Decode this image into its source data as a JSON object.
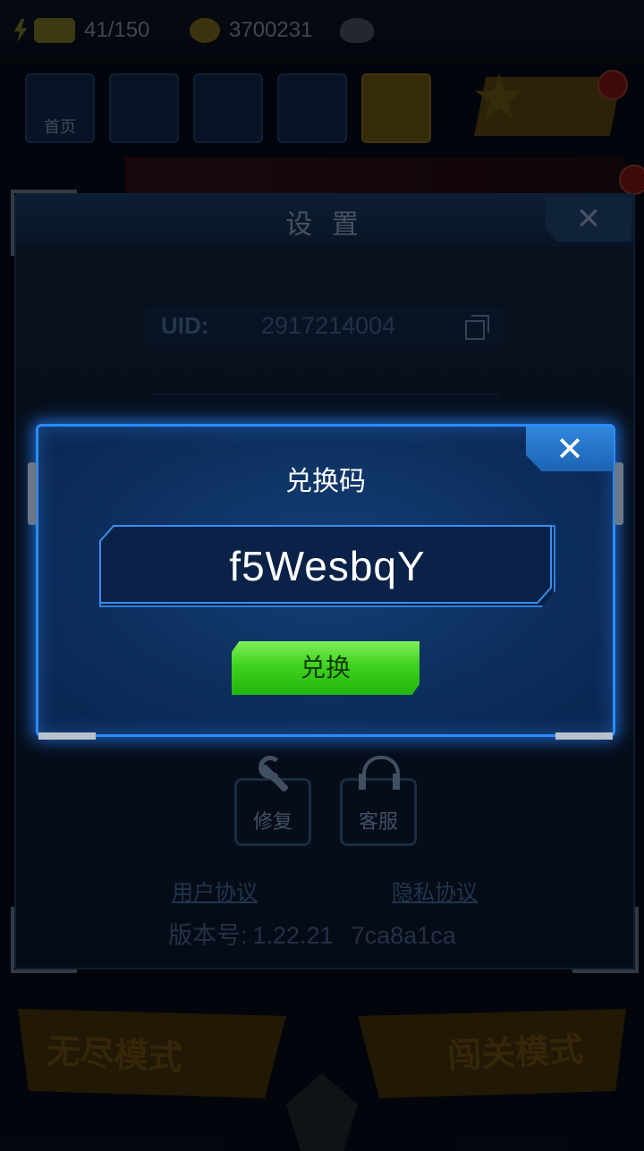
{
  "resources": {
    "energy": "41/150",
    "coins": "3700231",
    "gems": ""
  },
  "top_menu": [
    {
      "label": "首页"
    },
    {
      "label": ""
    },
    {
      "label": ""
    },
    {
      "label": ""
    },
    {
      "label": ""
    }
  ],
  "settings": {
    "title": "设 置",
    "close_glyph": "✕",
    "uid_label": "UID:",
    "uid_value": "2917214004",
    "repair_label": "修复",
    "support_label": "客服",
    "user_agreement": "用户协议",
    "privacy_agreement": "隐私协议",
    "version_label": "版本号:",
    "version_number": "1.22.21",
    "version_hash": "7ca8a1ca"
  },
  "modes": {
    "endless": "无尽模式",
    "level": "闯关模式"
  },
  "redeem_dialog": {
    "title": "兑换码",
    "code_value": "f5WesbqY",
    "redeem_button": "兑换",
    "close_glyph": "✕"
  },
  "colors": {
    "dialog_border": "#2a8cff",
    "button_green": "#3fd21e"
  }
}
